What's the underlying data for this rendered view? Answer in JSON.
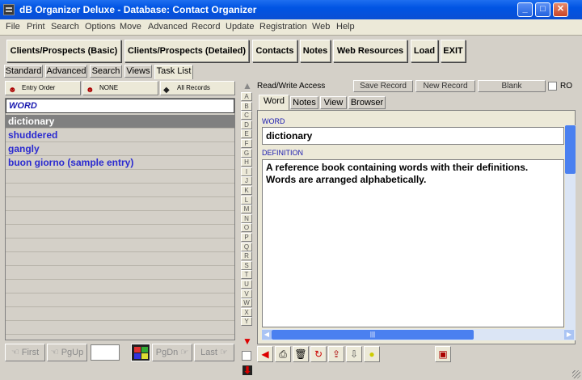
{
  "window": {
    "title": "dB Organizer Deluxe - Database: Contact Organizer",
    "min": "_",
    "max": "□",
    "close": "✕"
  },
  "menu": [
    "File",
    "Print",
    "Search",
    "Options",
    "Move",
    "Advanced",
    "Record",
    "Update",
    "Registration",
    "Web",
    "Help"
  ],
  "toolbar": [
    "Clients/Prospects (Basic)",
    "Clients/Prospects (Detailed)",
    "Contacts",
    "Notes",
    "Web Resources",
    "Load",
    "EXIT"
  ],
  "left_tabs": [
    "Standard",
    "Advanced",
    "Search",
    "Views",
    "Task List"
  ],
  "sort": {
    "order": "Entry Order",
    "filter": "NONE",
    "records": "All Records"
  },
  "list": {
    "header": "WORD",
    "rows": [
      "dictionary",
      "shuddered",
      "gangly",
      "buon giorno (sample entry)"
    ],
    "selected_index": 0
  },
  "nav": {
    "first": "First",
    "pgup": "PgUp",
    "pgdn": "PgDn",
    "last": "Last"
  },
  "alphabet": [
    "A",
    "B",
    "C",
    "D",
    "E",
    "F",
    "G",
    "H",
    "I",
    "J",
    "K",
    "L",
    "M",
    "N",
    "O",
    "P",
    "Q",
    "R",
    "S",
    "T",
    "U",
    "V",
    "W",
    "X",
    "Y"
  ],
  "record": {
    "access": "Read/Write Access",
    "save": "Save Record",
    "new": "New Record",
    "blank": "Blank",
    "ro": "RO"
  },
  "record_tabs": [
    "Word",
    "Notes",
    "View",
    "Browser"
  ],
  "fields": {
    "word_label": "WORD",
    "word_value": "dictionary",
    "definition_label": "DEFINITION",
    "definition_value": "A reference book containing words with their definitions. Words are arranged alphabetically."
  },
  "icons": {
    "bottom_toolbar": [
      "back-arrow-icon",
      "print-icon",
      "trash-icon",
      "refresh-icon",
      "export-icon",
      "import-icon",
      "lightbulb-icon",
      "save-disk-icon"
    ]
  },
  "colors": {
    "accent_text": "#1a1ab0",
    "selected_row": "#808080",
    "titlebar": "#0054e3"
  }
}
